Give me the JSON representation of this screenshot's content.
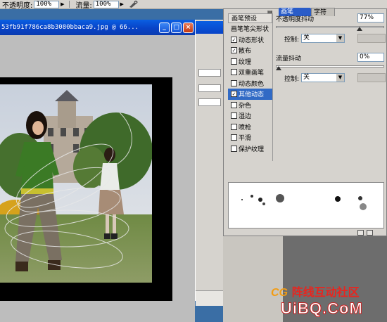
{
  "options_bar": {
    "opacity_label": "不透明度:",
    "opacity_value": "100%",
    "flow_label": "流量:",
    "flow_value": "100%",
    "airbrush_icon": "airbrush-icon"
  },
  "document": {
    "title": "53fb91f786ca8b3080bbaca9.jpg @ 66...",
    "minimize_label": "_",
    "maximize_label": "□",
    "close_label": "×"
  },
  "brush_panel": {
    "tabs": [
      {
        "label": "画笔",
        "active": true
      },
      {
        "label": "字符",
        "active": false
      }
    ],
    "list_header": "画笔预设",
    "list_items": [
      {
        "label": "画笔笔尖形状",
        "checkbox": false,
        "checked": false,
        "selected": false
      },
      {
        "label": "动态形状",
        "checkbox": true,
        "checked": true,
        "selected": false
      },
      {
        "label": "散布",
        "checkbox": true,
        "checked": true,
        "selected": false
      },
      {
        "label": "纹理",
        "checkbox": true,
        "checked": false,
        "selected": false
      },
      {
        "label": "双重画笔",
        "checkbox": true,
        "checked": false,
        "selected": false
      },
      {
        "label": "动态颜色",
        "checkbox": true,
        "checked": false,
        "selected": false
      },
      {
        "label": "其他动态",
        "checkbox": true,
        "checked": true,
        "selected": true
      },
      {
        "label": "杂色",
        "checkbox": true,
        "checked": false,
        "selected": false
      },
      {
        "label": "湿边",
        "checkbox": true,
        "checked": false,
        "selected": false
      },
      {
        "label": "喷枪",
        "checkbox": true,
        "checked": false,
        "selected": false
      },
      {
        "label": "平滑",
        "checkbox": true,
        "checked": false,
        "selected": false
      },
      {
        "label": "保护纹理",
        "checkbox": true,
        "checked": false,
        "selected": false
      }
    ],
    "opacity_jitter_label": "不透明度抖动",
    "opacity_jitter_value": "77%",
    "opacity_jitter_level": 0.77,
    "opacity_control_label": "控制:",
    "opacity_control_value": "关",
    "flow_jitter_label": "流量抖动",
    "flow_jitter_value": "0%",
    "flow_jitter_level": 0.0,
    "flow_control_label": "控制:",
    "flow_control_value": "关"
  },
  "watermark": {
    "cg": "CG",
    "line1": "阵线互动社区",
    "line2": "UiBQ.CoM"
  },
  "colors": {
    "title_bar": "#0843c7",
    "panel_bg": "#d6d3ce",
    "selected_item": "#316ac5"
  }
}
